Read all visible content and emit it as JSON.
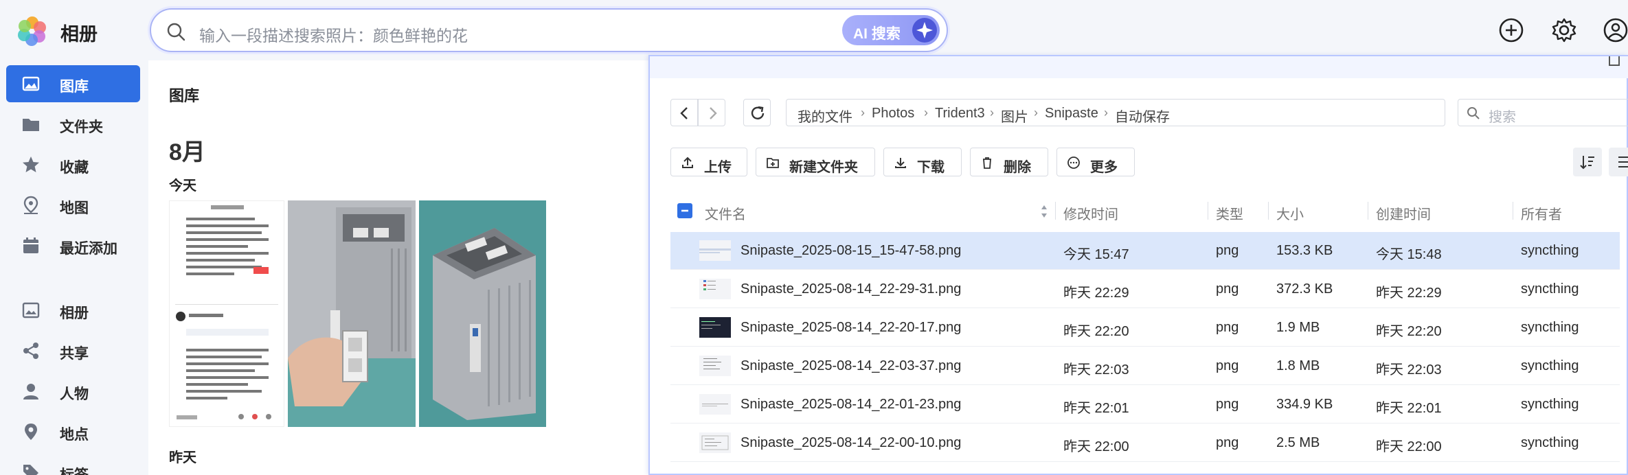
{
  "app": {
    "name": "相册"
  },
  "search": {
    "placeholder": "输入一段描述搜索照片：颜色鲜艳的花",
    "ai_label": "AI 搜索"
  },
  "colors": {
    "accent": "#2f6fe3",
    "ai_gradient": "#8e97f4",
    "selected_row": "#dbe7fb"
  },
  "sidebar": {
    "items": [
      {
        "label": "图库",
        "icon": "image-icon",
        "active": true
      },
      {
        "label": "文件夹",
        "icon": "folder-icon"
      },
      {
        "label": "收藏",
        "icon": "star-icon"
      },
      {
        "label": "地图",
        "icon": "map-pin-icon"
      },
      {
        "label": "最近添加",
        "icon": "calendar-icon"
      },
      {
        "label": "相册",
        "icon": "album-icon"
      },
      {
        "label": "共享",
        "icon": "share-icon"
      },
      {
        "label": "人物",
        "icon": "person-icon"
      },
      {
        "label": "地点",
        "icon": "location-icon"
      },
      {
        "label": "标签",
        "icon": "tag-icon"
      }
    ]
  },
  "gallery": {
    "title": "图库",
    "month": "8月",
    "today": "今天",
    "yesterday": "昨天"
  },
  "file_manager": {
    "breadcrumb": [
      "我的文件",
      "Photos",
      "Trident3",
      "图片",
      "Snipaste",
      "自动保存"
    ],
    "search_placeholder": "搜索",
    "toolbar": [
      "上传",
      "新建文件夹",
      "下载",
      "删除",
      "更多"
    ],
    "columns": [
      "文件名",
      "修改时间",
      "类型",
      "大小",
      "创建时间",
      "所有者"
    ],
    "files": [
      {
        "name": "Snipaste_2025-08-15_15-47-58.png",
        "modified": "今天 15:47",
        "type": "png",
        "size": "153.3 KB",
        "created": "今天 15:48",
        "owner": "syncthing"
      },
      {
        "name": "Snipaste_2025-08-14_22-29-31.png",
        "modified": "昨天 22:29",
        "type": "png",
        "size": "372.3 KB",
        "created": "昨天 22:29",
        "owner": "syncthing"
      },
      {
        "name": "Snipaste_2025-08-14_22-20-17.png",
        "modified": "昨天 22:20",
        "type": "png",
        "size": "1.9 MB",
        "created": "昨天 22:20",
        "owner": "syncthing"
      },
      {
        "name": "Snipaste_2025-08-14_22-03-37.png",
        "modified": "昨天 22:03",
        "type": "png",
        "size": "1.8 MB",
        "created": "昨天 22:03",
        "owner": "syncthing"
      },
      {
        "name": "Snipaste_2025-08-14_22-01-23.png",
        "modified": "昨天 22:01",
        "type": "png",
        "size": "334.9 KB",
        "created": "昨天 22:01",
        "owner": "syncthing"
      },
      {
        "name": "Snipaste_2025-08-14_22-00-10.png",
        "modified": "昨天 22:00",
        "type": "png",
        "size": "2.5 MB",
        "created": "昨天 22:00",
        "owner": "syncthing"
      }
    ]
  }
}
